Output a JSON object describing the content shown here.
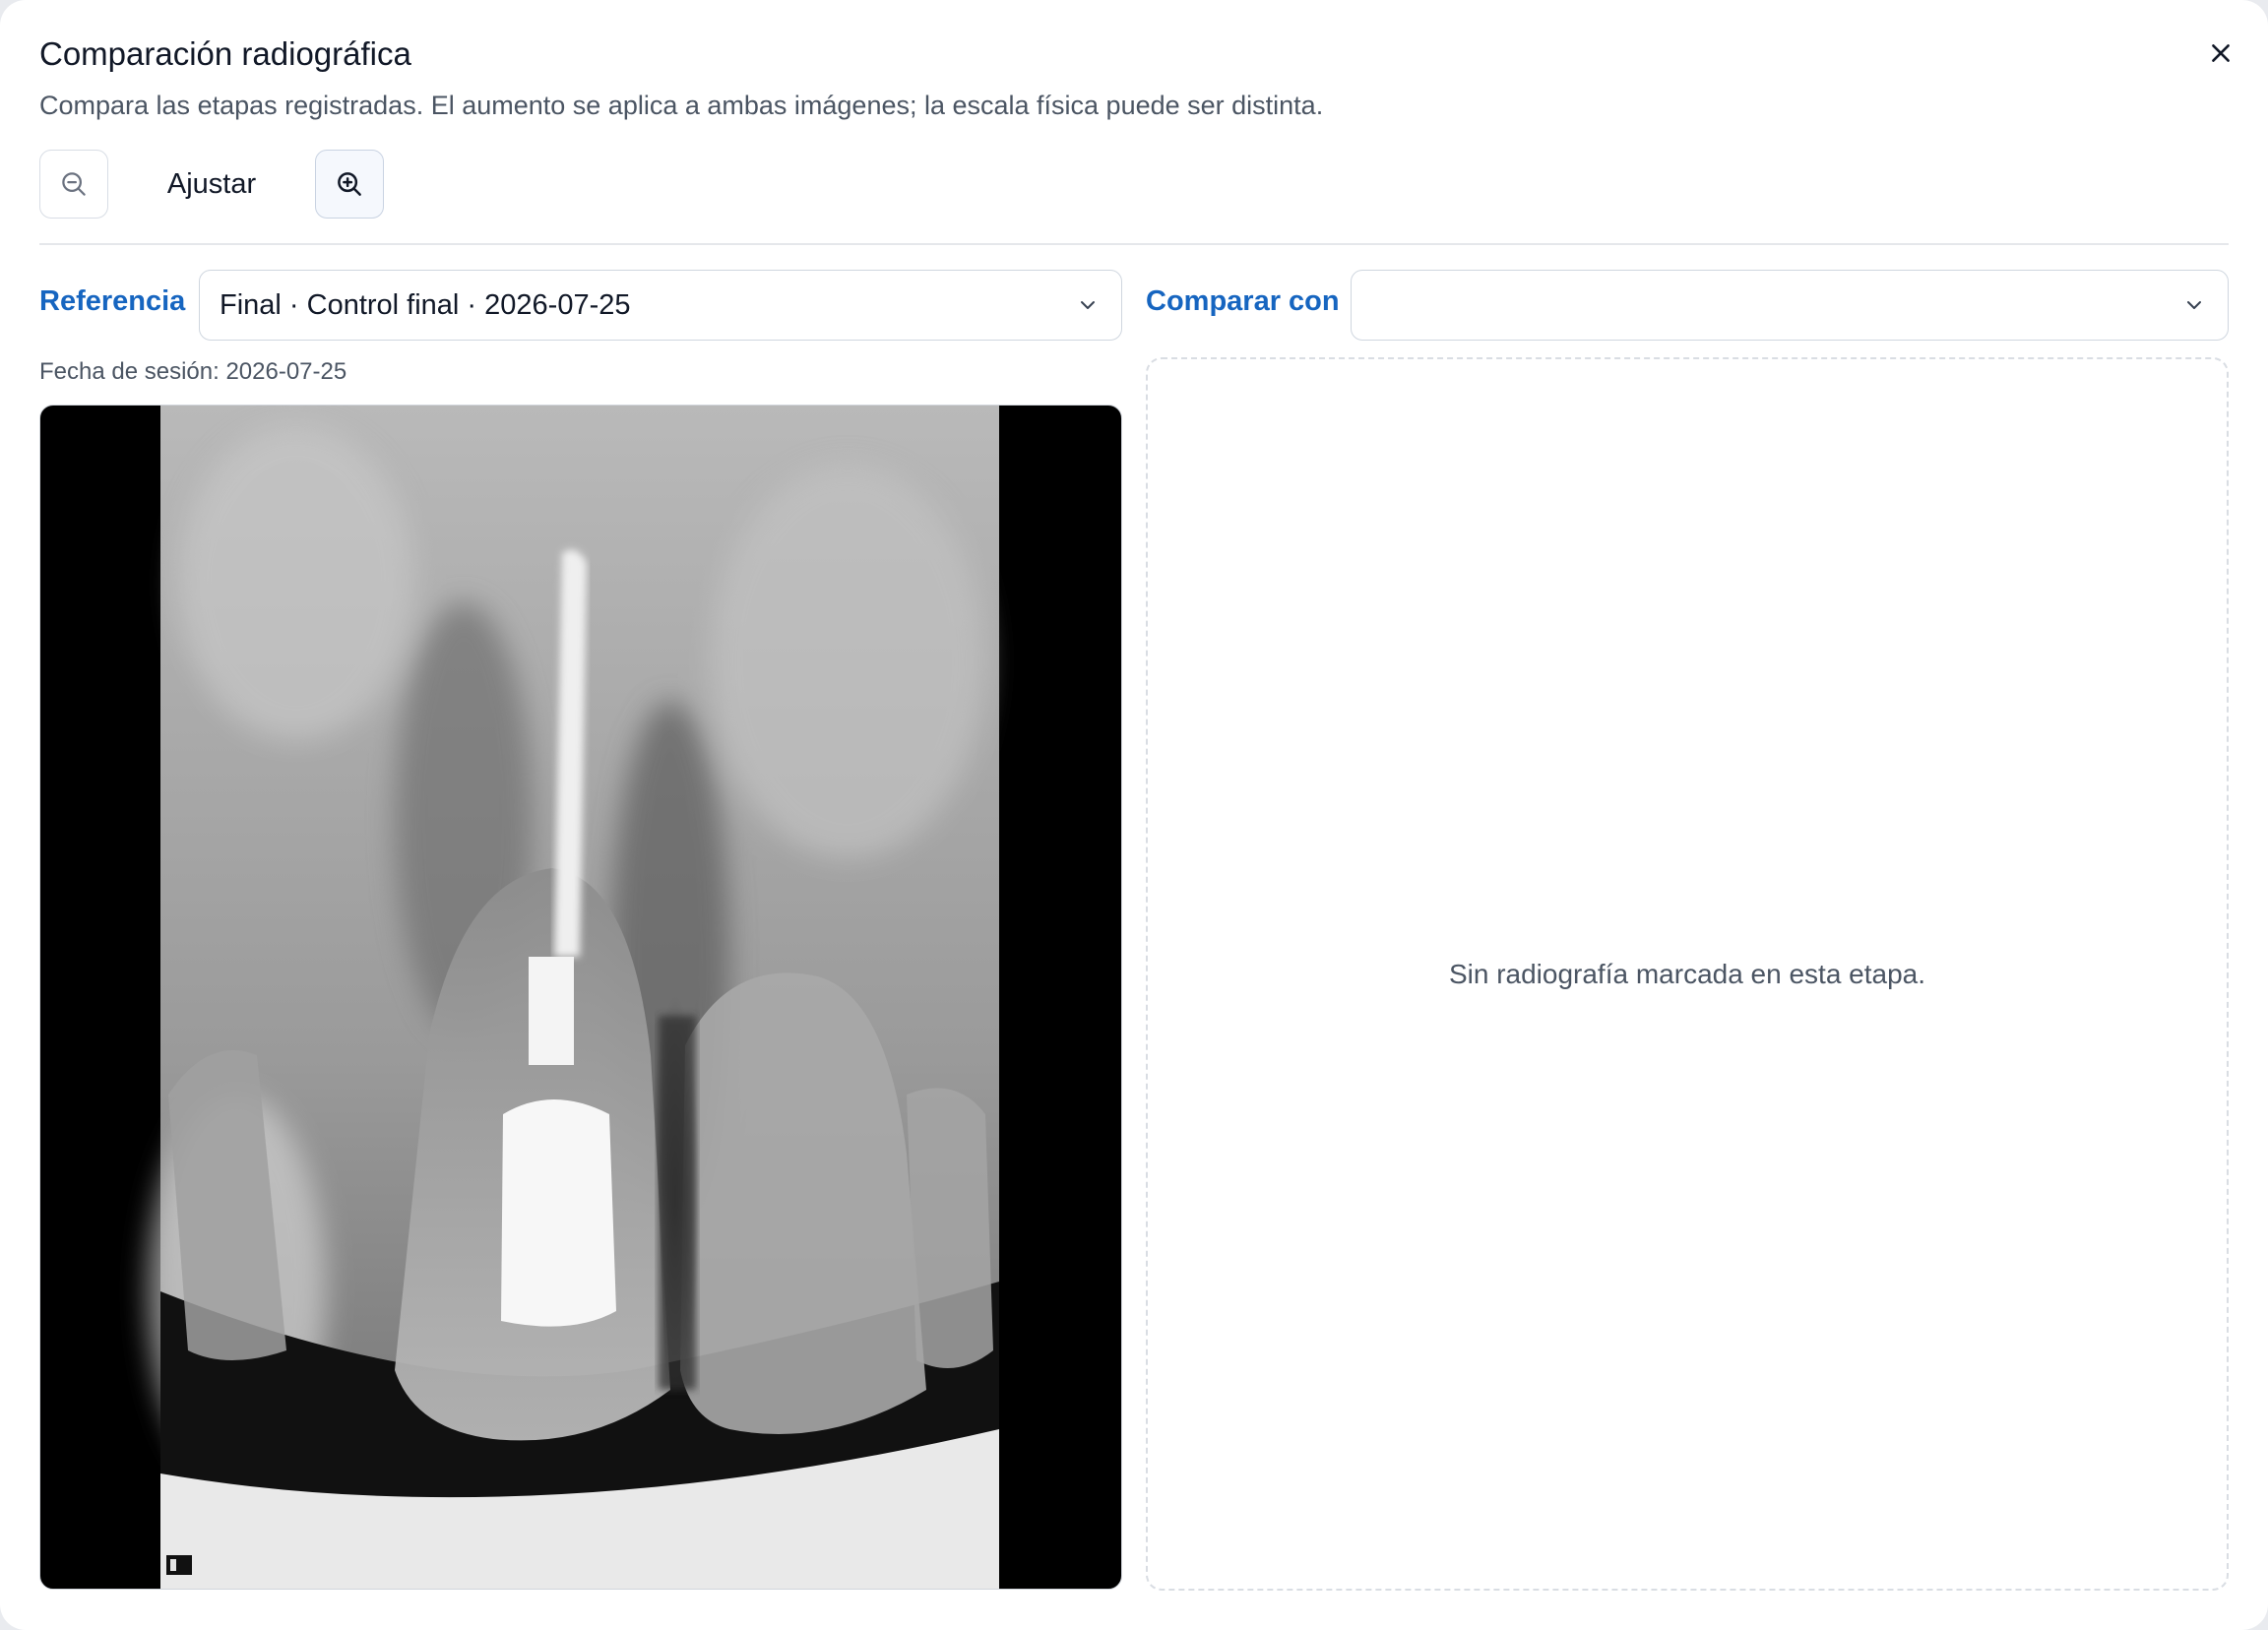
{
  "dialog": {
    "title": "Comparación radiográfica",
    "subtitle": "Compara las etapas registradas. El aumento se aplica a ambas imágenes; la escala física puede ser distinta.",
    "close_icon": "close-icon"
  },
  "toolbar": {
    "zoom_out_icon": "zoom-out-icon",
    "fit_label": "Ajustar",
    "zoom_in_icon": "zoom-in-icon"
  },
  "reference": {
    "label": "Referencia",
    "selected": "Final · Control final · 2026-07-25",
    "session_date": "Fecha de sesión: 2026-07-25"
  },
  "compare": {
    "label": "Comparar con",
    "selected": "",
    "empty_message": "Sin radiografía marcada en esta etapa."
  },
  "colors": {
    "accent": "#1665c0",
    "text": "#111827",
    "muted": "#4b5563",
    "border": "#cfd6df"
  }
}
